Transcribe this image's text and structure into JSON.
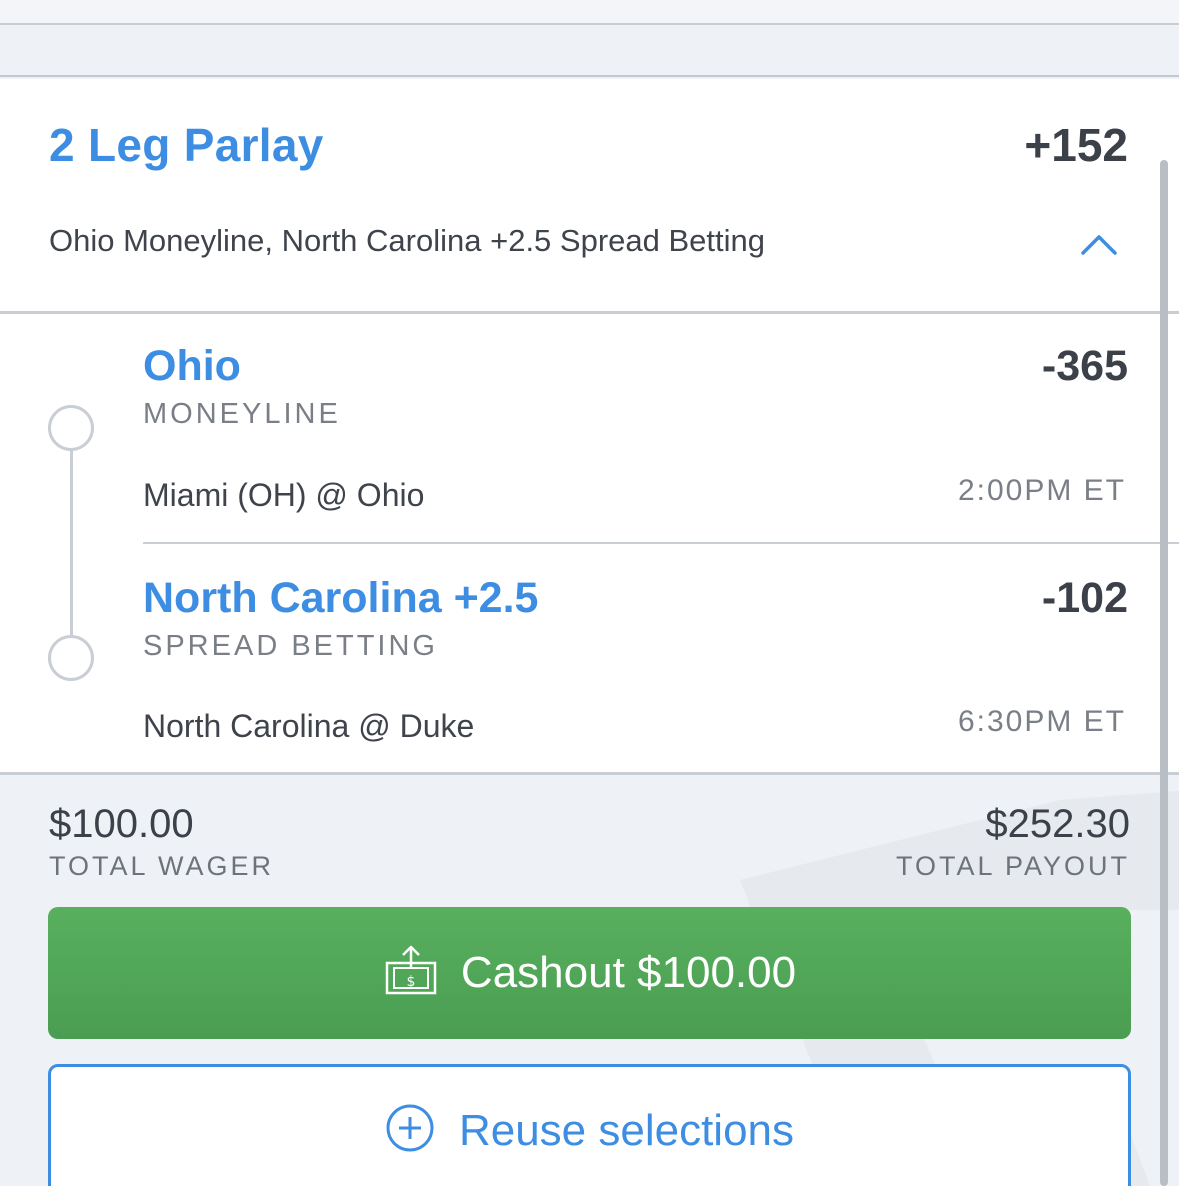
{
  "parlay": {
    "title": "2 Leg Parlay",
    "odds": "+152",
    "description": "Ohio Moneyline, North Carolina +2.5 Spread Betting"
  },
  "legs": [
    {
      "selection": "Ohio",
      "market": "MONEYLINE",
      "odds": "-365",
      "matchup": "Miami (OH) @ Ohio",
      "time": "2:00PM ET"
    },
    {
      "selection": "North Carolina +2.5",
      "market": "SPREAD BETTING",
      "odds": "-102",
      "matchup": "North Carolina @ Duke",
      "time": "6:30PM ET"
    }
  ],
  "summary": {
    "wager_amount": "$100.00",
    "wager_label": "TOTAL WAGER",
    "payout_amount": "$252.30",
    "payout_label": "TOTAL PAYOUT"
  },
  "actions": {
    "cashout_label": "Cashout $100.00",
    "reuse_label": "Reuse selections"
  },
  "icons": {
    "collapse": "chevron-up-icon",
    "cashout": "cashout-money-icon",
    "reuse": "plus-circle-icon"
  },
  "colors": {
    "accent_blue": "#3d8ee3",
    "cashout_green": "#52a858",
    "text_dark": "#3b4049",
    "text_muted": "#7a7f87"
  }
}
